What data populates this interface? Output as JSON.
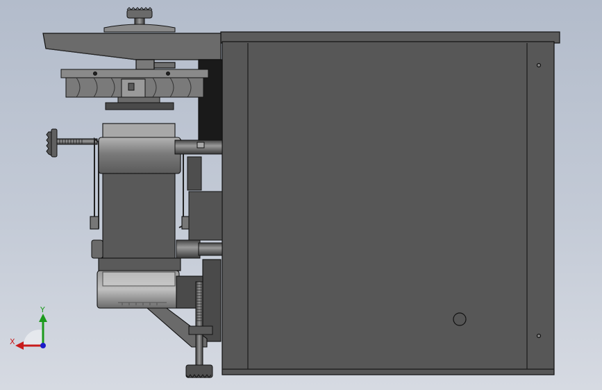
{
  "triad": {
    "x_label": "X",
    "y_label": "Y",
    "x_color": "#c81c1c",
    "y_color": "#1c9a1c",
    "z_color": "#1c1cc8"
  },
  "model": {
    "body_color": "#545454",
    "edge_color": "#111111",
    "view": "front-orthographic"
  }
}
